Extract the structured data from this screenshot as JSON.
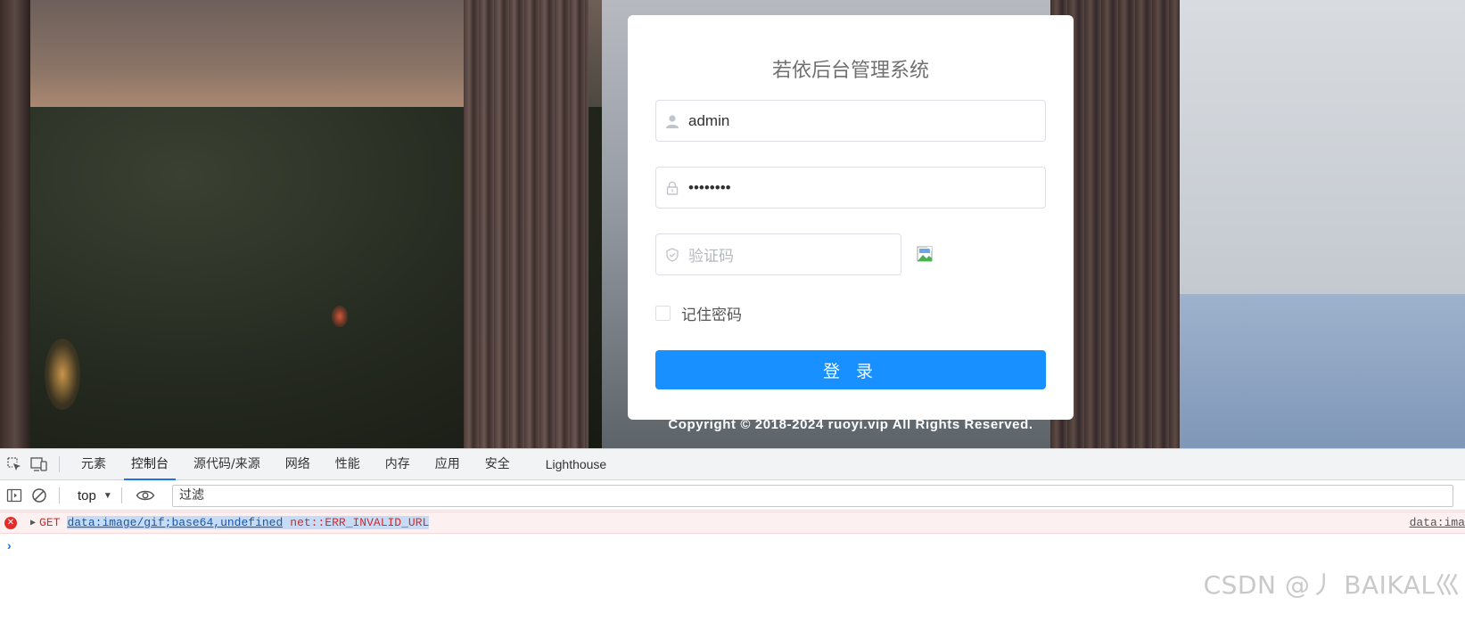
{
  "login": {
    "title": "若依后台管理系统",
    "username_value": "admin",
    "password_value": "••••••••",
    "captcha_placeholder": "验证码",
    "remember_label": "记住密码",
    "remember_checked": false,
    "login_button": "登 录",
    "copyright": "Copyright © 2018-2024 ruoyi.vip All Rights Reserved."
  },
  "devtools": {
    "tabs": [
      "元素",
      "控制台",
      "源代码/来源",
      "网络",
      "性能",
      "内存",
      "应用",
      "安全",
      "Lighthouse"
    ],
    "active_tab": "控制台",
    "context": "top",
    "filter_placeholder": "过滤",
    "console": {
      "error": {
        "method": "GET",
        "url": "data:image/gif;base64,undefined",
        "message": "net::ERR_INVALID_URL",
        "source": "data:ima"
      },
      "prompt": "›"
    }
  },
  "watermark": "CSDN @丿 BAIKAL巛",
  "colors": {
    "primary": "#1890ff",
    "error": "#d42a2a",
    "tab_underline": "#1a73e8"
  }
}
